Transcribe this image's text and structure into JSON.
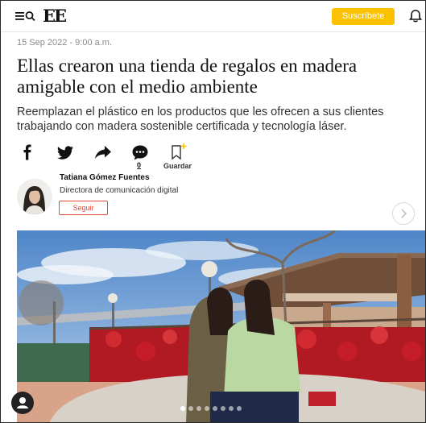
{
  "header": {
    "logo_text": "EE",
    "subscribe_label": "Suscríbete",
    "icons": [
      "menu-icon",
      "search-icon",
      "bell-icon"
    ],
    "accent_color": "#fcc200"
  },
  "article": {
    "date": "15 Sep 2022 - 9:00 a.m.",
    "headline": "Ellas crearon una tienda de regalos en madera amigable con el medio ambiente",
    "subheadline": "Reemplazan el plástico en los productos que les ofrecen a sus clientes trabajando con madera sostenible certificada y tecnología láser."
  },
  "share": {
    "icons": [
      "facebook-icon",
      "twitter-icon",
      "share-icon",
      "comments-icon",
      "bookmark-icon"
    ],
    "comments_count": "0",
    "save_label": "Guardar"
  },
  "author": {
    "name": "Tatiana Gómez Fuentes",
    "role": "Directora de comunicación digital",
    "follow_label": "Seguir",
    "follow_color": "#e64a3c"
  },
  "gallery": {
    "dot_count": 8,
    "active_index": 0
  }
}
